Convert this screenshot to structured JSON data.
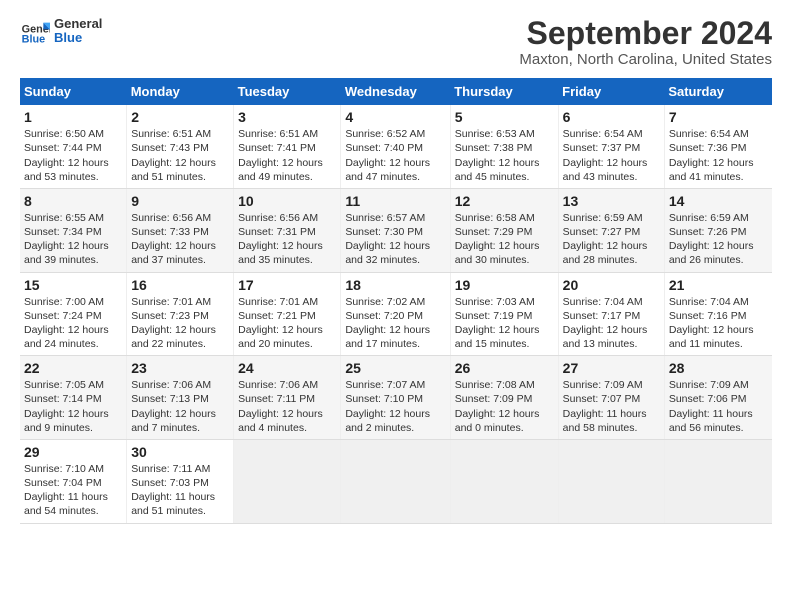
{
  "header": {
    "logo_line1": "General",
    "logo_line2": "Blue",
    "title": "September 2024",
    "subtitle": "Maxton, North Carolina, United States"
  },
  "calendar": {
    "days_of_week": [
      "Sunday",
      "Monday",
      "Tuesday",
      "Wednesday",
      "Thursday",
      "Friday",
      "Saturday"
    ],
    "weeks": [
      [
        {
          "day": 1,
          "sunrise": "6:50 AM",
          "sunset": "7:44 PM",
          "daylight": "12 hours and 53 minutes."
        },
        {
          "day": 2,
          "sunrise": "6:51 AM",
          "sunset": "7:43 PM",
          "daylight": "12 hours and 51 minutes."
        },
        {
          "day": 3,
          "sunrise": "6:51 AM",
          "sunset": "7:41 PM",
          "daylight": "12 hours and 49 minutes."
        },
        {
          "day": 4,
          "sunrise": "6:52 AM",
          "sunset": "7:40 PM",
          "daylight": "12 hours and 47 minutes."
        },
        {
          "day": 5,
          "sunrise": "6:53 AM",
          "sunset": "7:38 PM",
          "daylight": "12 hours and 45 minutes."
        },
        {
          "day": 6,
          "sunrise": "6:54 AM",
          "sunset": "7:37 PM",
          "daylight": "12 hours and 43 minutes."
        },
        {
          "day": 7,
          "sunrise": "6:54 AM",
          "sunset": "7:36 PM",
          "daylight": "12 hours and 41 minutes."
        }
      ],
      [
        {
          "day": 8,
          "sunrise": "6:55 AM",
          "sunset": "7:34 PM",
          "daylight": "12 hours and 39 minutes."
        },
        {
          "day": 9,
          "sunrise": "6:56 AM",
          "sunset": "7:33 PM",
          "daylight": "12 hours and 37 minutes."
        },
        {
          "day": 10,
          "sunrise": "6:56 AM",
          "sunset": "7:31 PM",
          "daylight": "12 hours and 35 minutes."
        },
        {
          "day": 11,
          "sunrise": "6:57 AM",
          "sunset": "7:30 PM",
          "daylight": "12 hours and 32 minutes."
        },
        {
          "day": 12,
          "sunrise": "6:58 AM",
          "sunset": "7:29 PM",
          "daylight": "12 hours and 30 minutes."
        },
        {
          "day": 13,
          "sunrise": "6:59 AM",
          "sunset": "7:27 PM",
          "daylight": "12 hours and 28 minutes."
        },
        {
          "day": 14,
          "sunrise": "6:59 AM",
          "sunset": "7:26 PM",
          "daylight": "12 hours and 26 minutes."
        }
      ],
      [
        {
          "day": 15,
          "sunrise": "7:00 AM",
          "sunset": "7:24 PM",
          "daylight": "12 hours and 24 minutes."
        },
        {
          "day": 16,
          "sunrise": "7:01 AM",
          "sunset": "7:23 PM",
          "daylight": "12 hours and 22 minutes."
        },
        {
          "day": 17,
          "sunrise": "7:01 AM",
          "sunset": "7:21 PM",
          "daylight": "12 hours and 20 minutes."
        },
        {
          "day": 18,
          "sunrise": "7:02 AM",
          "sunset": "7:20 PM",
          "daylight": "12 hours and 17 minutes."
        },
        {
          "day": 19,
          "sunrise": "7:03 AM",
          "sunset": "7:19 PM",
          "daylight": "12 hours and 15 minutes."
        },
        {
          "day": 20,
          "sunrise": "7:04 AM",
          "sunset": "7:17 PM",
          "daylight": "12 hours and 13 minutes."
        },
        {
          "day": 21,
          "sunrise": "7:04 AM",
          "sunset": "7:16 PM",
          "daylight": "12 hours and 11 minutes."
        }
      ],
      [
        {
          "day": 22,
          "sunrise": "7:05 AM",
          "sunset": "7:14 PM",
          "daylight": "12 hours and 9 minutes."
        },
        {
          "day": 23,
          "sunrise": "7:06 AM",
          "sunset": "7:13 PM",
          "daylight": "12 hours and 7 minutes."
        },
        {
          "day": 24,
          "sunrise": "7:06 AM",
          "sunset": "7:11 PM",
          "daylight": "12 hours and 4 minutes."
        },
        {
          "day": 25,
          "sunrise": "7:07 AM",
          "sunset": "7:10 PM",
          "daylight": "12 hours and 2 minutes."
        },
        {
          "day": 26,
          "sunrise": "7:08 AM",
          "sunset": "7:09 PM",
          "daylight": "12 hours and 0 minutes."
        },
        {
          "day": 27,
          "sunrise": "7:09 AM",
          "sunset": "7:07 PM",
          "daylight": "11 hours and 58 minutes."
        },
        {
          "day": 28,
          "sunrise": "7:09 AM",
          "sunset": "7:06 PM",
          "daylight": "11 hours and 56 minutes."
        }
      ],
      [
        {
          "day": 29,
          "sunrise": "7:10 AM",
          "sunset": "7:04 PM",
          "daylight": "11 hours and 54 minutes."
        },
        {
          "day": 30,
          "sunrise": "7:11 AM",
          "sunset": "7:03 PM",
          "daylight": "11 hours and 51 minutes."
        },
        null,
        null,
        null,
        null,
        null
      ]
    ]
  }
}
